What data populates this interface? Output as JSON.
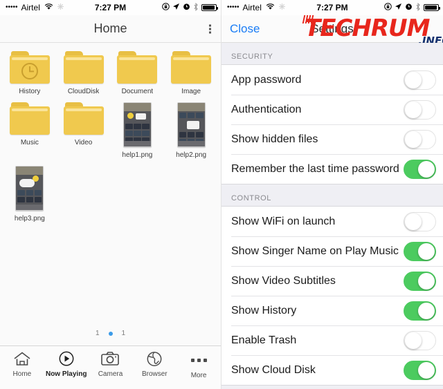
{
  "status_bar": {
    "signal_dots": "•••••",
    "carrier": "Airtel",
    "wifi_icon": "wifi-icon",
    "sync_icon": "sync-icon",
    "time": "7:27 PM",
    "rotation_lock_icon": "rotation-lock-icon",
    "location_icon": "location-arrow-icon",
    "alarm_icon": "alarm-clock-icon",
    "bluetooth_icon": "bluetooth-icon",
    "battery_icon": "battery-icon"
  },
  "left_panel": {
    "nav": {
      "title": "Home",
      "overflow_icon": "kebab-menu-icon"
    },
    "files": [
      {
        "name": "History",
        "kind": "folder",
        "icon": "folder-clock-icon"
      },
      {
        "name": "CloudDisk",
        "kind": "folder",
        "icon": "folder-icon"
      },
      {
        "name": "Document",
        "kind": "folder",
        "icon": "folder-icon"
      },
      {
        "name": "Image",
        "kind": "folder",
        "icon": "folder-icon"
      },
      {
        "name": "Music",
        "kind": "folder",
        "icon": "folder-icon"
      },
      {
        "name": "Video",
        "kind": "folder",
        "icon": "folder-icon"
      },
      {
        "name": "help1.png",
        "kind": "image",
        "icon": "image-thumbnail"
      },
      {
        "name": "help2.png",
        "kind": "image",
        "icon": "image-thumbnail"
      },
      {
        "name": "help3.png",
        "kind": "image",
        "icon": "image-thumbnail"
      }
    ],
    "pagination": {
      "left_number": "1",
      "right_number": "1",
      "active_dot_color": "#3b9be8"
    },
    "tabs": [
      {
        "label": "Home",
        "icon": "home-icon",
        "active": false
      },
      {
        "label": "Now Playing",
        "icon": "play-circle-icon",
        "active": true
      },
      {
        "label": "Camera",
        "icon": "camera-icon",
        "active": false
      },
      {
        "label": "Browser",
        "icon": "globe-icon",
        "active": false
      },
      {
        "label": "More",
        "icon": "ellipsis-icon",
        "active": false
      }
    ]
  },
  "right_panel": {
    "nav": {
      "close_label": "Close",
      "title": "Settings",
      "close_color": "#1a7cf5"
    },
    "watermark": {
      "main": "TECHRUM",
      "suffix": ".INFO",
      "main_color": "#e8261c",
      "suffix_color": "#13306e",
      "bar_color": "#2c6fd1"
    },
    "sections": [
      {
        "header": "SECURITY",
        "rows": [
          {
            "label": "App password",
            "on": false
          },
          {
            "label": "Authentication",
            "on": false
          },
          {
            "label": "Show hidden files",
            "on": false
          },
          {
            "label": "Remember the last time password",
            "on": true
          }
        ]
      },
      {
        "header": "CONTROL",
        "rows": [
          {
            "label": "Show WiFi on launch",
            "on": false
          },
          {
            "label": "Show Singer Name on Play Music",
            "on": true
          },
          {
            "label": "Show Video Subtitles",
            "on": true
          },
          {
            "label": "Show History",
            "on": true
          },
          {
            "label": "Enable Trash",
            "on": false
          },
          {
            "label": "Show Cloud Disk",
            "on": true
          }
        ]
      }
    ],
    "toggle_on_color": "#4ccb5f"
  }
}
